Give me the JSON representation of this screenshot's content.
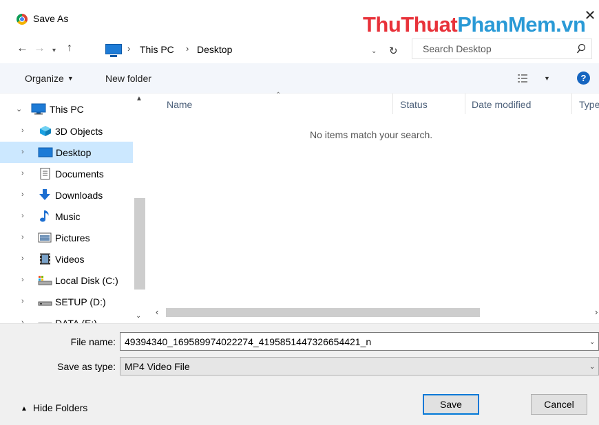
{
  "window": {
    "title": "Save As",
    "watermark_part1": "ThuThuat",
    "watermark_part2": "PhanMem.vn"
  },
  "nav": {
    "back": "←",
    "forward": "→",
    "recent": "⌄",
    "up": "↑"
  },
  "address": {
    "sep1": "›",
    "crumb1": "This PC",
    "sep2": "›",
    "crumb2": "Desktop"
  },
  "search": {
    "placeholder": "Search Desktop"
  },
  "toolbar": {
    "organize_label": "Organize",
    "new_folder_label": "New folder",
    "help_label": "?"
  },
  "tree": {
    "root": "This PC",
    "items": [
      {
        "label": "3D Objects",
        "icon": "3d-objects-icon"
      },
      {
        "label": "Desktop",
        "icon": "desktop-icon",
        "selected": true
      },
      {
        "label": "Documents",
        "icon": "documents-icon"
      },
      {
        "label": "Downloads",
        "icon": "downloads-icon"
      },
      {
        "label": "Music",
        "icon": "music-icon"
      },
      {
        "label": "Pictures",
        "icon": "pictures-icon"
      },
      {
        "label": "Videos",
        "icon": "videos-icon"
      },
      {
        "label": "Local Disk (C:)",
        "icon": "local-disk-icon"
      },
      {
        "label": "SETUP (D:)",
        "icon": "drive-icon"
      },
      {
        "label": "DATA (E:)",
        "icon": "drive-icon"
      }
    ]
  },
  "columns": {
    "name": "Name",
    "status": "Status",
    "date_modified": "Date modified",
    "type": "Type"
  },
  "content": {
    "empty_message": "No items match your search."
  },
  "form": {
    "file_name_label": "File name:",
    "file_name_value": "49394340_169589974022274_4195851447326654421_n",
    "save_type_label": "Save as type:",
    "save_type_value": "MP4 Video File"
  },
  "footer": {
    "hide_folders_label": "Hide Folders",
    "save_label": "Save",
    "cancel_label": "Cancel"
  },
  "colors": {
    "selection": "#cce8ff",
    "accent": "#0078d7",
    "toolbar_bg": "#f3f6fb"
  }
}
